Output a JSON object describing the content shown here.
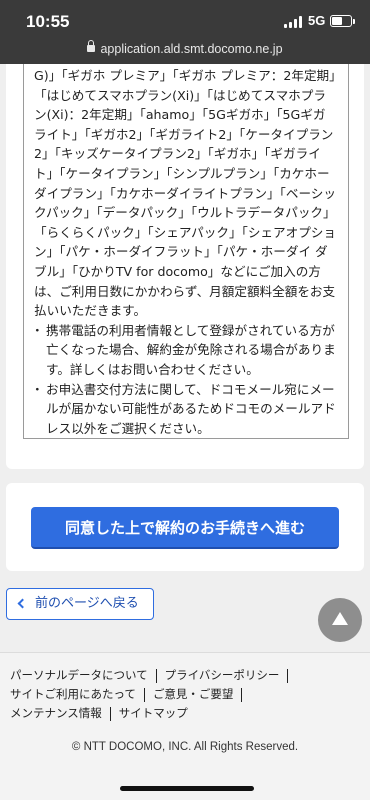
{
  "status_bar": {
    "time": "10:55",
    "network": "5G",
    "battery_percent": 60
  },
  "url_bar": {
    "url": "application.ald.smt.docomo.ne.jp"
  },
  "terms": {
    "paragraph": "G)」「ギガホ プレミア」「ギガホ プレミア：2年定期」「はじめてスマホプラン(Xi)」「はじめてスマホプラン(Xi)：2年定期」「ahamo」「5Gギガホ」「5Gギガライト」「ギガホ2」「ギガライト2」「ケータイプラン2」「キッズケータイプラン2」「ギガホ」「ギガライト」「ケータイプラン」「シンプルプラン」「カケホーダイプラン」「カケホーダイライトプラン」「ベーシックパック」「データパック」「ウルトラデータパック」「らくらくパック」「シェアパック」「シェアオプション」「パケ・ホーダイフラット」「パケ・ホーダイ ダブル」「ひかりTV for docomo」などにご加入の方は、ご利用日数にかかわらず、月額定額料全額をお支払いいただきます。",
    "bullets": [
      "携帯電話の利用者情報として登録がされている方が亡くなった場合、解約金が免除される場合があります。詳しくはお問い合わせください。",
      "お申込書交付方法に関して、ドコモメール宛にメールが届かない可能性があるためドコモのメールアドレス以外をご選択ください。"
    ]
  },
  "actions": {
    "proceed_label": "同意した上で解約のお手続きへ進む",
    "back_label": "前のページへ戻る"
  },
  "footer": {
    "links": [
      "パーソナルデータについて",
      "プライバシーポリシー",
      "サイトご利用にあたって",
      "ご意見・ご要望",
      "メンテナンス情報",
      "サイトマップ"
    ],
    "copyright": "© NTT DOCOMO, INC. All Rights Reserved."
  },
  "colors": {
    "primary": "#2f6de0",
    "status_bar": "#3a3a3a",
    "background": "#efefef"
  },
  "icons": [
    "signal-icon",
    "battery-icon",
    "lock-icon",
    "chevron-left-icon",
    "arrow-up-icon"
  ]
}
